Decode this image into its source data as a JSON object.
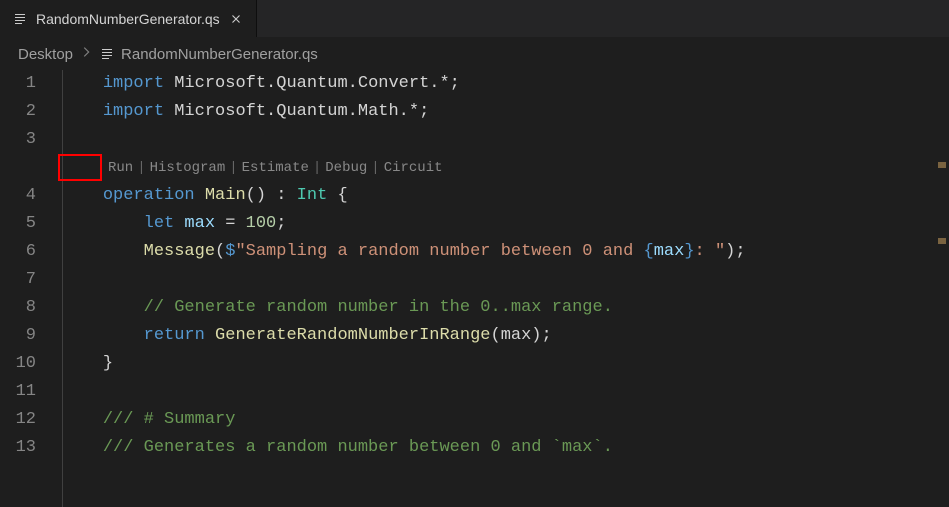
{
  "tab": {
    "filename": "RandomNumberGenerator.qs"
  },
  "breadcrumb": {
    "segment1": "Desktop",
    "segment2": "RandomNumberGenerator.qs"
  },
  "code_lens": {
    "run": "Run",
    "histogram": "Histogram",
    "estimate": "Estimate",
    "debug": "Debug",
    "circuit": "Circuit"
  },
  "gutter": [
    "1",
    "2",
    "3",
    "4",
    "5",
    "6",
    "7",
    "8",
    "9",
    "10",
    "11",
    "12",
    "13"
  ],
  "code": {
    "line1": {
      "kw": "import",
      "rest": " Microsoft.Quantum.Convert.*;"
    },
    "line2": {
      "kw": "import",
      "rest": " Microsoft.Quantum.Math.*;"
    },
    "line4": {
      "kw": "operation",
      "name": " Main",
      "sig": "() : ",
      "type": "Int",
      "brace": " {"
    },
    "line5": {
      "kw": "let",
      "var": " max",
      "eq": " = ",
      "num": "100",
      "semi": ";"
    },
    "line6": {
      "fn": "Message",
      "paren": "(",
      "dollar": "$",
      "str1": "\"Sampling a random number between 0 and ",
      "interp_open": "{",
      "interp_var": "max",
      "interp_close": "}",
      "str2": ": \"",
      "close": ");"
    },
    "line8": {
      "cmt": "// Generate random number in the 0..max range."
    },
    "line9": {
      "kw": "return",
      "fn": " GenerateRandomNumberInRange",
      "args": "(max);"
    },
    "line10": {
      "brace": "}"
    },
    "line12": {
      "cmt": "/// # Summary"
    },
    "line13": {
      "cmt": "/// Generates a random number between 0 and `max`."
    }
  }
}
